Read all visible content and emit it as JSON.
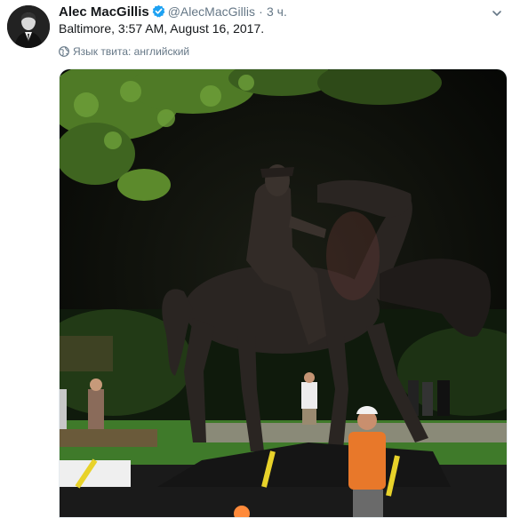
{
  "tweet": {
    "author_name": "Alec MacGillis",
    "handle": "@AlecMacGillis",
    "separator": "·",
    "time": "3 ч.",
    "text": "Baltimore, 3:57 AM, August 16, 2017.",
    "language_note": "Язык твита: английский"
  },
  "icons": {
    "verified": "verified-badge-icon",
    "caret": "chevron-down-icon",
    "globe": "globe-icon"
  },
  "colors": {
    "name": "#14171a",
    "muted": "#657786",
    "verified": "#1da1f2"
  }
}
